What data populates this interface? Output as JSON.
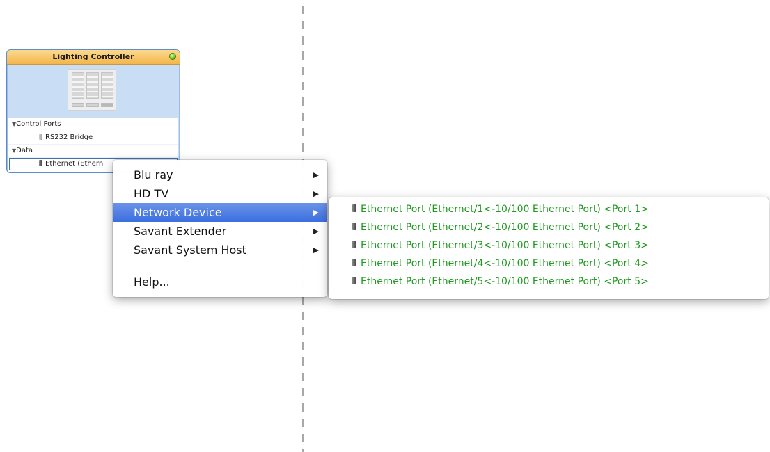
{
  "node": {
    "title": "Lighting Controller",
    "status_icon": "status-green-icon",
    "ports": [
      {
        "type": "group",
        "label": "Control Ports"
      },
      {
        "type": "port",
        "label": "RS232 Bridge",
        "icon": "serial-plug-icon"
      },
      {
        "type": "group",
        "label": "Data"
      },
      {
        "type": "port",
        "label": "Ethernet (Ethern",
        "icon": "ethernet-plug-icon",
        "selected": true
      }
    ]
  },
  "context_menu": {
    "items": [
      {
        "label": "Blu ray",
        "submenu": true
      },
      {
        "label": "HD TV",
        "submenu": true
      },
      {
        "label": "Network Device",
        "submenu": true,
        "highlighted": true
      },
      {
        "label": "Savant Extender",
        "submenu": true
      },
      {
        "label": "Savant System Host",
        "submenu": true
      }
    ],
    "help_label": "Help...",
    "arrow_glyph": "▶",
    "highlight_color": "#3b6ee0"
  },
  "submenu": {
    "text_color": "#1f9a1f",
    "items": [
      {
        "label": "Ethernet Port (Ethernet/1<-10/100 Ethernet Port) <Port 1>"
      },
      {
        "label": "Ethernet Port (Ethernet/2<-10/100 Ethernet Port) <Port 2>"
      },
      {
        "label": "Ethernet Port (Ethernet/3<-10/100 Ethernet Port) <Port 3>"
      },
      {
        "label": "Ethernet Port (Ethernet/4<-10/100 Ethernet Port) <Port 4>"
      },
      {
        "label": "Ethernet Port (Ethernet/5<-10/100 Ethernet Port) <Port 5>"
      }
    ]
  }
}
